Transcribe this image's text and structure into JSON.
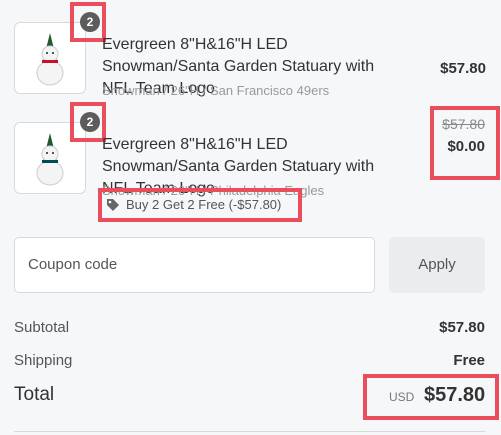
{
  "items": [
    {
      "quantity": "2",
      "title": "Evergreen 8\"H&16\"H LED Snowman/Santa Garden Statuary with NFL Team Logo",
      "variant": "Snowman / 26\"H / San Francisco 49ers",
      "price": "$57.80",
      "image_icon": "snowman-figurine",
      "scarf_color": "#c8102e"
    },
    {
      "quantity": "2",
      "title": "Evergreen 8\"H&16\"H LED Snowman/Santa Garden Statuary with NFL Team Logo",
      "variant": "Snowman / 26\"H / Philadelphia Eagles",
      "original_price": "$57.80",
      "price": "$0.00",
      "discount_icon": "tag-icon",
      "discount_label": "Buy 2 Get 2 Free (-$57.80)",
      "image_icon": "snowman-figurine",
      "scarf_color": "#004c54"
    }
  ],
  "coupon": {
    "placeholder": "Coupon code",
    "apply_label": "Apply"
  },
  "summary": {
    "subtotal_label": "Subtotal",
    "subtotal_value": "$57.80",
    "shipping_label": "Shipping",
    "shipping_value": "Free",
    "total_label": "Total",
    "currency": "USD",
    "total_value": "$57.80"
  },
  "highlight_color": "#ea4d5c"
}
